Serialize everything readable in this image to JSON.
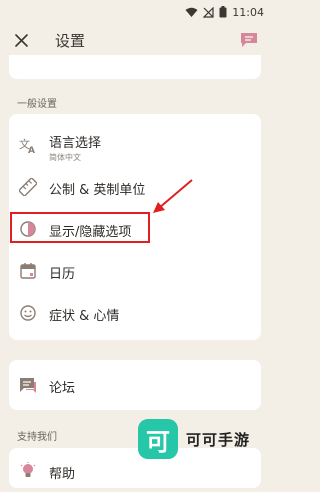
{
  "status_bar": {
    "time": "11:04"
  },
  "app_bar": {
    "title": "设置"
  },
  "sections": {
    "general": {
      "header": "一般设置",
      "items": [
        {
          "label": "语言选择",
          "sublabel": "简体中文"
        },
        {
          "label": "公制 & 英制单位"
        },
        {
          "label": "显示/隐藏选项"
        },
        {
          "label": "日历"
        },
        {
          "label": "症状 & 心情"
        }
      ]
    },
    "community": {
      "items": [
        {
          "label": "论坛"
        }
      ]
    },
    "support": {
      "header": "支持我们",
      "items": [
        {
          "label": "帮助"
        }
      ]
    }
  },
  "watermark": {
    "badge": "可",
    "text": "可可手游"
  },
  "colors": {
    "background": "#f3efe6",
    "card": "#ffffff",
    "icon": "#8a7d74",
    "accent_pink": "#d6879a",
    "highlight": "#e02020",
    "watermark_badge": "#26c6a8"
  }
}
